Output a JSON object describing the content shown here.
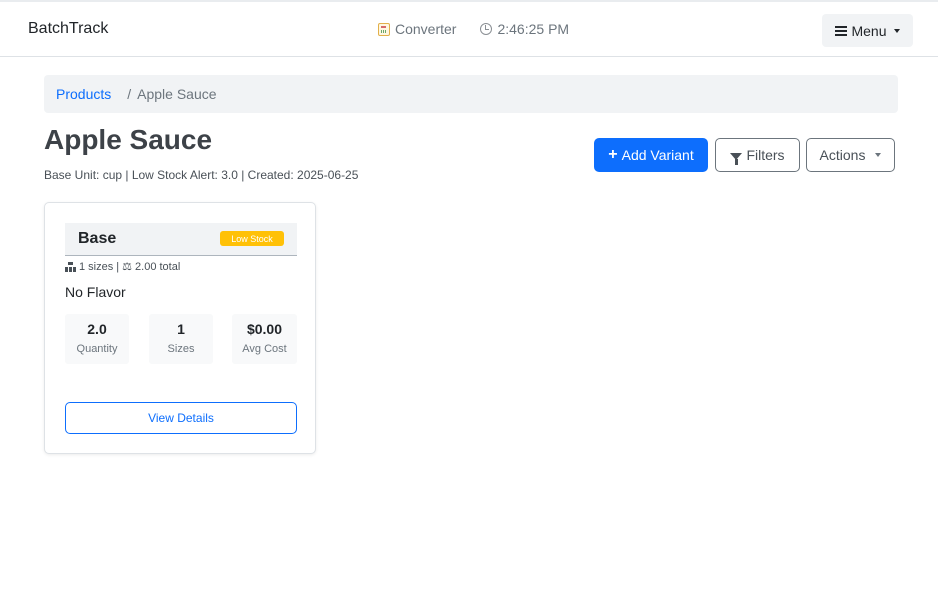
{
  "navbar": {
    "brand": "BatchTrack",
    "converter_label": "Converter",
    "converter_icon": "calculator-icon",
    "time": "2:46:25 PM",
    "time_icon": "clock-icon",
    "menu_label": "Menu"
  },
  "breadcrumb": {
    "parent": "Products",
    "separator": "/",
    "current": "Apple Sauce"
  },
  "page": {
    "title": "Apple Sauce",
    "meta": "Base Unit: cup | Low Stock Alert: 3.0 | Created: 2025-06-25"
  },
  "actions": {
    "add_variant": "Add Variant",
    "filters": "Filters",
    "actions": "Actions"
  },
  "variants": [
    {
      "name": "Base",
      "badge": "Low Stock",
      "sizes_summary": "1 sizes |",
      "total_summary": "2.00 total",
      "flavor": "No Flavor",
      "stats": [
        {
          "value": "2.0",
          "label": "Quantity"
        },
        {
          "value": "1",
          "label": "Sizes"
        },
        {
          "value": "$0.00",
          "label": "Avg Cost"
        }
      ],
      "view_label": "View Details"
    }
  ],
  "colors": {
    "primary": "#0d6efd",
    "warning": "#ffc107",
    "muted": "#6c757d"
  }
}
